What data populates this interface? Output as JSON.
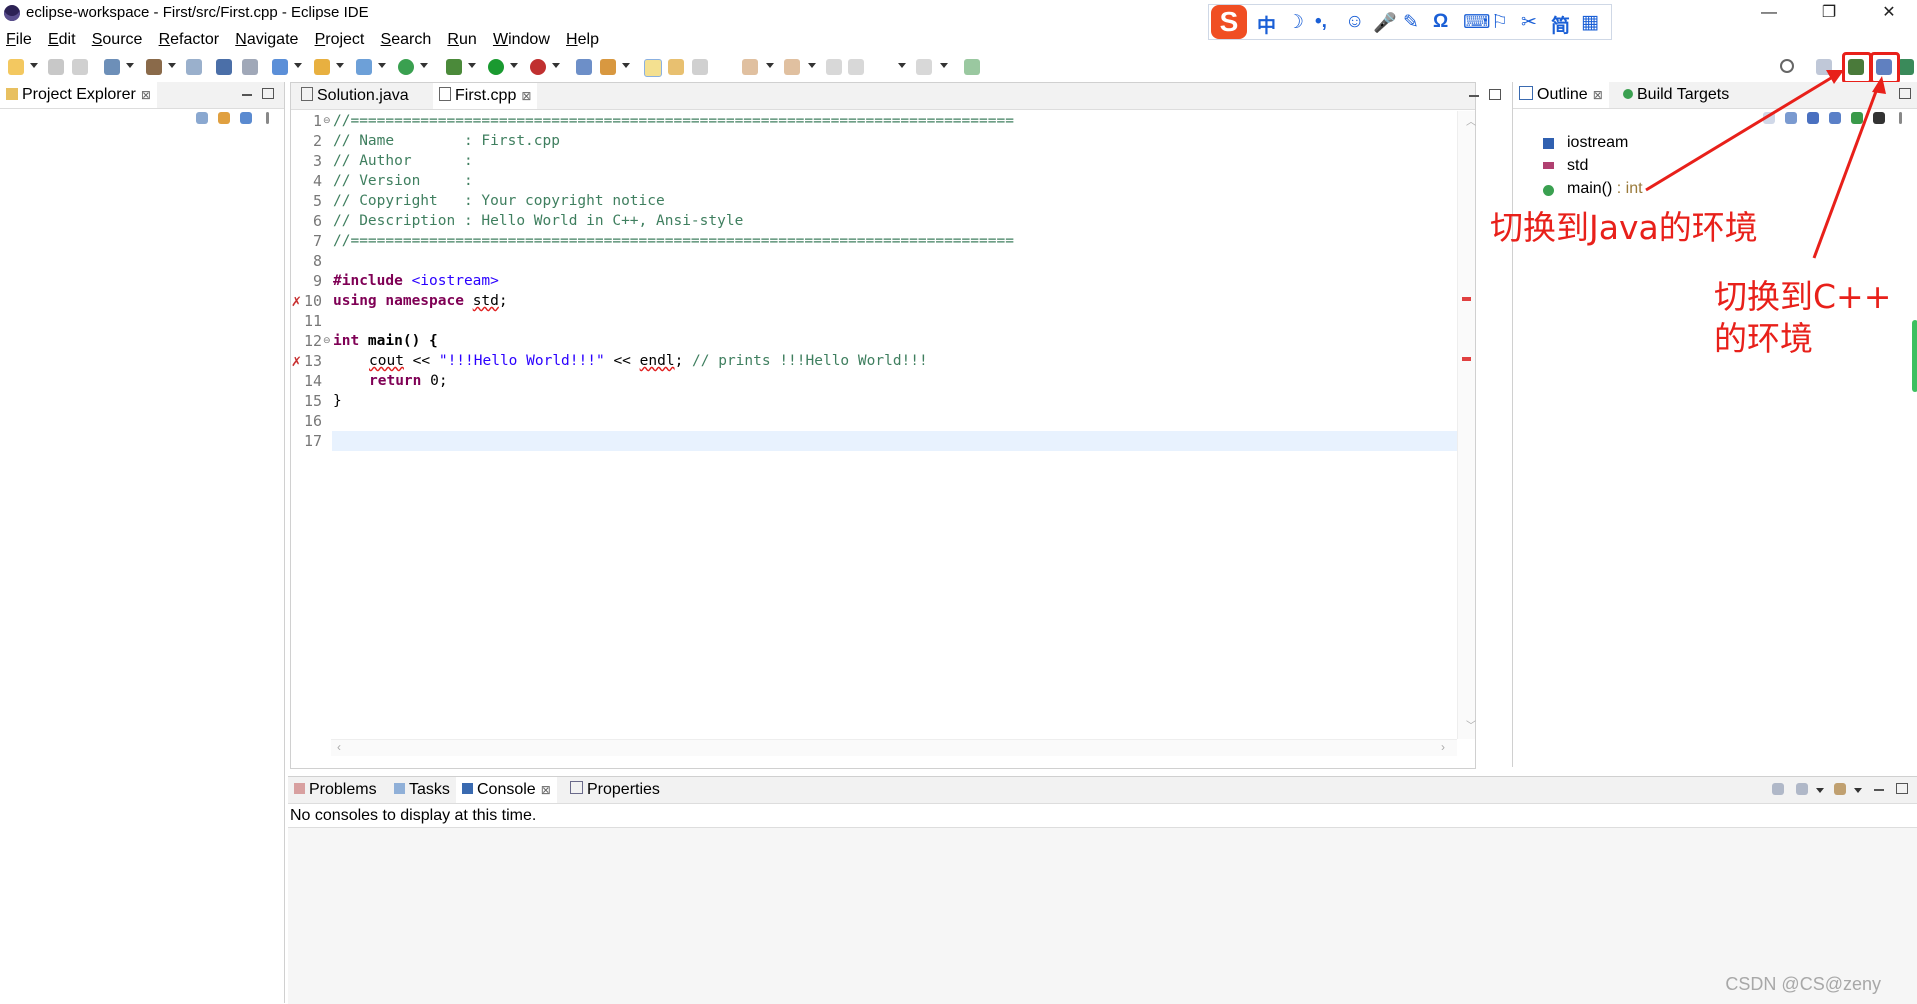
{
  "window": {
    "title": "eclipse-workspace - First/src/First.cpp - Eclipse IDE",
    "minimize": "—",
    "restore": "❐",
    "close": "✕"
  },
  "menu": [
    "File",
    "Edit",
    "Source",
    "Refactor",
    "Navigate",
    "Project",
    "Search",
    "Run",
    "Window",
    "Help"
  ],
  "ime": {
    "logo": "S",
    "items": [
      "中",
      "☽",
      "•,",
      "☺",
      "🎤",
      "✎",
      "Ω",
      "⌨",
      "⚐",
      "✂",
      "简",
      "▦"
    ]
  },
  "explorer": {
    "tab_label": "Project Explorer"
  },
  "editor": {
    "tabs": [
      {
        "label": "Solution.java",
        "active": false
      },
      {
        "label": "First.cpp",
        "active": true
      }
    ],
    "line_numbers": [
      "1",
      "2",
      "3",
      "4",
      "5",
      "6",
      "7",
      "8",
      "9",
      "10",
      "11",
      "12",
      "13",
      "14",
      "15",
      "16",
      "17"
    ],
    "lines": {
      "l1": "//============================================================================",
      "l2": "// Name        : First.cpp",
      "l3": "// Author      :",
      "l4": "// Version     :",
      "l5": "// Copyright   : Your copyright notice",
      "l6": "// Description : Hello World in C++, Ansi-style",
      "l7": "//============================================================================",
      "l9_kw": "#include",
      "l9_rest": "<iostream>",
      "l10_kw": "using namespace",
      "l10_rest": "std",
      "l10_end": ";",
      "l12_kw": "int",
      "l12_rest": " main() {",
      "l13_a": "cout",
      "l13_b": " << ",
      "l13_str": "\"!!!Hello World!!!\"",
      "l13_c": " << ",
      "l13_d": "endl",
      "l13_e": "; ",
      "l13_cmt": "// prints !!!Hello World!!!",
      "l14_kw": "return",
      "l14_rest": " 0;",
      "l15": "}"
    }
  },
  "outline": {
    "tabs": [
      {
        "label": "Outline",
        "active": true
      },
      {
        "label": "Build Targets",
        "active": false
      }
    ],
    "items": [
      {
        "label": "iostream",
        "suffix": ""
      },
      {
        "label": "std",
        "suffix": ""
      },
      {
        "label": "main()",
        "suffix": " : int"
      }
    ]
  },
  "console": {
    "tabs": [
      "Problems",
      "Tasks",
      "Console",
      "Properties"
    ],
    "message": "No consoles to display at this time."
  },
  "annotations": {
    "java": "切换到Java的环境",
    "cpp_line1": "切换到C++",
    "cpp_line2": "的环境"
  },
  "watermark": "CSDN @CS@zeny",
  "colors": {
    "annotation_red": "#e8201a",
    "comment_green": "#3f7f5f",
    "keyword_purple": "#7f0055",
    "string_blue": "#2a00ff",
    "current_line": "#e8f2fe"
  }
}
